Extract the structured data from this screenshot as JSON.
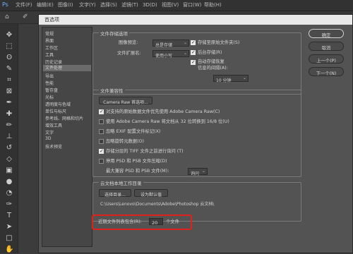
{
  "menubar": {
    "items": [
      "文件(F)",
      "编辑(E)",
      "图像(I)",
      "文字(Y)",
      "选择(S)",
      "滤镜(T)",
      "3D(D)",
      "视图(V)",
      "窗口(W)",
      "帮助(H)"
    ]
  },
  "dialog": {
    "title": "首选项",
    "categories": [
      "常规",
      "界面",
      "工作区",
      "工具",
      "历史记录",
      "文件处理",
      "导出",
      "性能",
      "暂存盘",
      "光标",
      "透明度与色域",
      "单位与标尺",
      "参考线、网格和切片",
      "增效工具",
      "文字",
      "3D",
      "技术预览"
    ],
    "selected_category": "文件处理",
    "save_options": {
      "title": "文件存储选项",
      "preview_label": "图像预览:",
      "preview_value": "总是存储",
      "extension_label": "文件扩展名:",
      "extension_value": "使用小写",
      "save_as_original_label": "存储至原始文件夹(S)",
      "bg_save_label": "后台存储(R)",
      "auto_save_label_1": "自动存储恢复",
      "auto_save_label_2": "信息的间隔(A):",
      "interval_value": "10 分钟"
    },
    "compat": {
      "title": "文件兼容性",
      "camera_raw_button": "Camera Raw 首选项...",
      "options": [
        {
          "label": "对支持的原始数据文件优先使用 Adobe Camera Raw(C)",
          "checked": true
        },
        {
          "label": "使用 Adobe Camera Raw 将文档从 32 位转换到 16/8 位(U)",
          "checked": false
        },
        {
          "label": "忽略 EXIF 配置文件标记(X)",
          "checked": false
        },
        {
          "label": "忽略旋转元数据(O)",
          "checked": false
        },
        {
          "label": "存储分层的 TIFF 文件之前进行询问 (T)",
          "checked": true
        },
        {
          "label": "停用 PSD 和 PSB 文件压缩(D)",
          "checked": false
        }
      ],
      "maximize_label": "最大兼容 PSD 和 PSB 文件(M):",
      "maximize_value": "询问"
    },
    "cloud": {
      "title": "云文档本地工作目录",
      "choose_button": "选择目录...",
      "default_button": "设为默认值",
      "path": "C:\\Users\\Lenovo\\Documents\\Adobe\\Photoshop 云文档\\"
    },
    "recent": {
      "label": "近期文件列表包含(R):",
      "value": "20",
      "unit": "个文件"
    },
    "buttons": {
      "ok": "确定",
      "cancel": "取消",
      "prev": "上一个(P)",
      "next": "下一个(N)"
    }
  },
  "colors": {
    "dialog_bg": "#535353",
    "highlight": "#e0201a"
  }
}
